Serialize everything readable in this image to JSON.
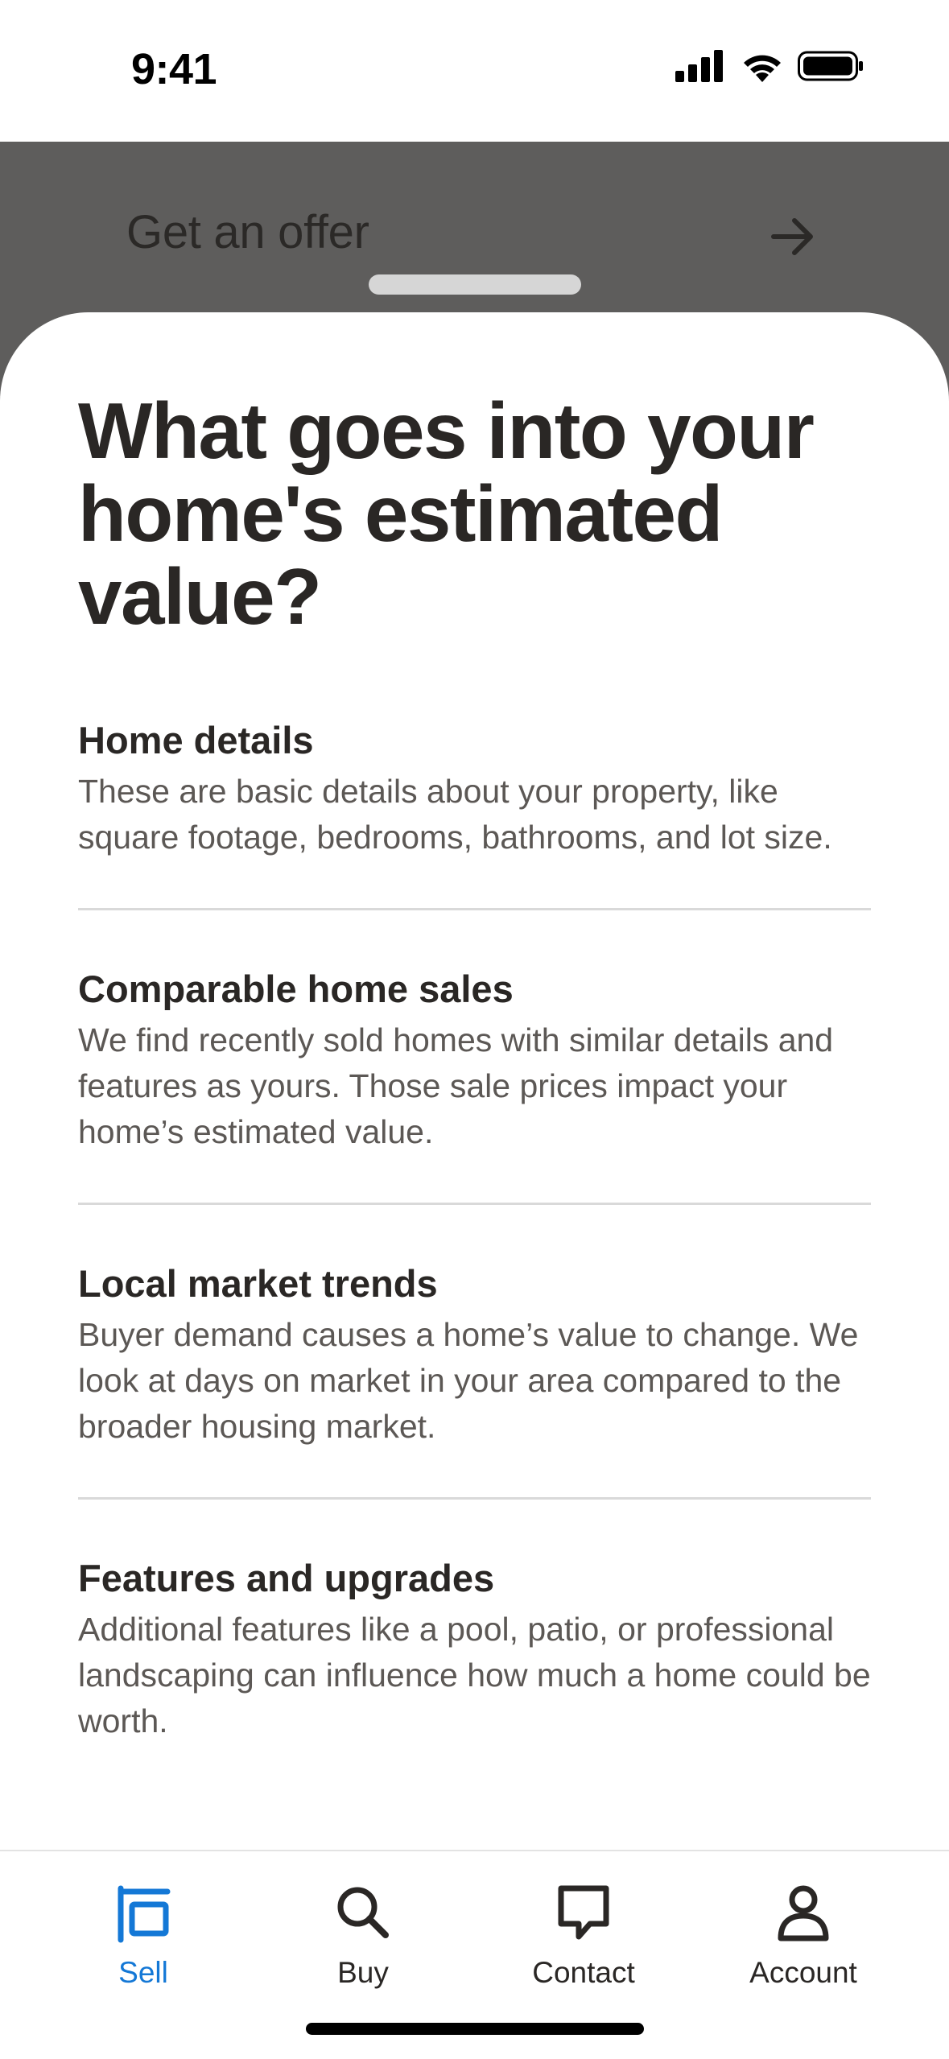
{
  "status_bar": {
    "time": "9:41",
    "icons": [
      "cellular-signal-icon",
      "wifi-icon",
      "battery-icon"
    ]
  },
  "background_sheet": {
    "title": "Get an offer",
    "arrow_icon": "arrow-right-icon"
  },
  "sheet": {
    "title": "What goes into your home's estimated value?",
    "sections": [
      {
        "heading": "Home details",
        "body": "These are basic details about your property, like square footage, bedrooms, bathrooms, and lot size."
      },
      {
        "heading": "Comparable home sales",
        "body": "We find recently sold homes with similar details and features as yours. Those sale prices impact your home’s estimated value."
      },
      {
        "heading": "Local market trends",
        "body": "Buyer demand causes a home’s value to change. We look at days on market in your area compared to the broader housing market."
      },
      {
        "heading": "Features and upgrades",
        "body": "Additional features like a pool, patio, or professional landscaping can influence how much a home could be worth."
      }
    ]
  },
  "tab_bar": {
    "active_color": "#1478d6",
    "tabs": [
      {
        "label": "Sell",
        "icon": "sell-icon",
        "active": true
      },
      {
        "label": "Buy",
        "icon": "search-icon",
        "active": false
      },
      {
        "label": "Contact",
        "icon": "chat-bubble-icon",
        "active": false
      },
      {
        "label": "Account",
        "icon": "person-icon",
        "active": false
      }
    ]
  }
}
